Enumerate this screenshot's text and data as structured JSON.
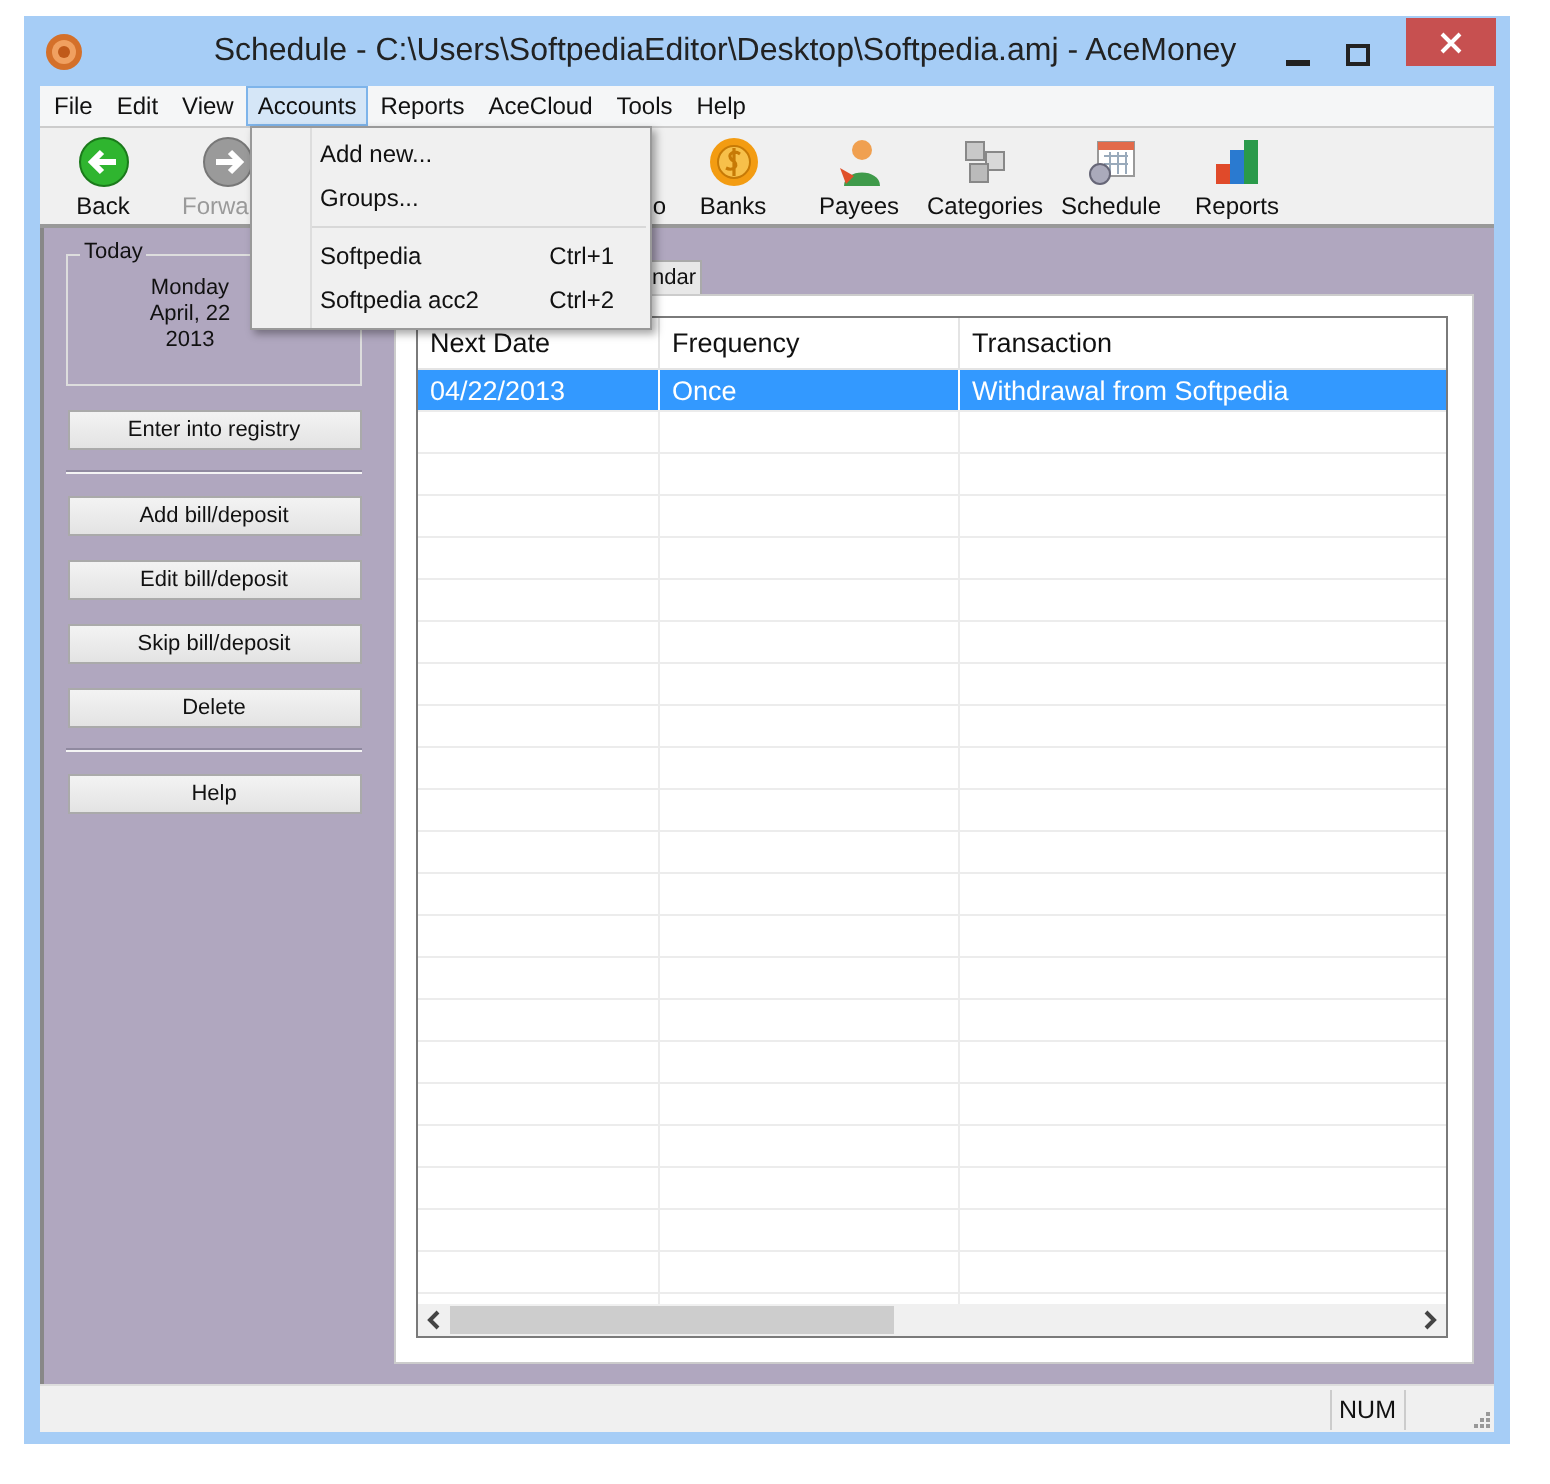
{
  "window": {
    "title": "Schedule - C:\\Users\\SoftpediaEditor\\Desktop\\Softpedia.amj - AceMoney"
  },
  "menu_bar": [
    {
      "label": "File",
      "selected": false
    },
    {
      "label": "Edit",
      "selected": false
    },
    {
      "label": "View",
      "selected": false
    },
    {
      "label": "Accounts",
      "selected": true
    },
    {
      "label": "Reports",
      "selected": false
    },
    {
      "label": "AceCloud",
      "selected": false
    },
    {
      "label": "Tools",
      "selected": false
    },
    {
      "label": "Help",
      "selected": false
    }
  ],
  "accounts_menu": [
    {
      "kind": "item",
      "label": "Add new..."
    },
    {
      "kind": "item",
      "label": "Groups..."
    },
    {
      "kind": "separator"
    },
    {
      "kind": "item",
      "label": "Softpedia",
      "shortcut": "Ctrl+1"
    },
    {
      "kind": "item",
      "label": "Softpedia acc2",
      "shortcut": "Ctrl+2"
    }
  ],
  "toolbar": [
    {
      "kind": "full",
      "label": "Back",
      "disabled": false
    },
    {
      "kind": "cut",
      "label": "Forwa",
      "disabled": true
    },
    {
      "kind": "covered",
      "label": "o",
      "disabled": false
    },
    {
      "kind": "full",
      "label": "Banks",
      "disabled": false
    },
    {
      "kind": "full",
      "label": "Payees",
      "disabled": false
    },
    {
      "kind": "full",
      "label": "Categories",
      "disabled": false
    },
    {
      "kind": "full",
      "label": "Schedule",
      "disabled": false
    },
    {
      "kind": "full",
      "label": "Reports",
      "disabled": false
    }
  ],
  "today": {
    "title": "Today",
    "lines": [
      "Monday",
      "April, 22",
      "2013"
    ]
  },
  "side_buttons": [
    {
      "kind": "button",
      "label": "Enter into registry"
    },
    {
      "kind": "separator"
    },
    {
      "kind": "button",
      "label": "Add bill/deposit"
    },
    {
      "kind": "button",
      "label": "Edit bill/deposit"
    },
    {
      "kind": "button",
      "label": "Skip bill/deposit"
    },
    {
      "kind": "button",
      "label": "Delete"
    },
    {
      "kind": "separator"
    },
    {
      "kind": "button",
      "label": "Help"
    }
  ],
  "tabs": [
    {
      "label": "ndar",
      "selected": false
    }
  ],
  "table": {
    "columns": [
      "Next Date",
      "Frequency",
      "Transaction"
    ],
    "rows": [
      {
        "cells": [
          "04/22/2013",
          "Once",
          "Withdrawal from Softpedia"
        ],
        "selected": true
      }
    ]
  },
  "status_bar": {
    "panels": [
      "NUM"
    ]
  }
}
